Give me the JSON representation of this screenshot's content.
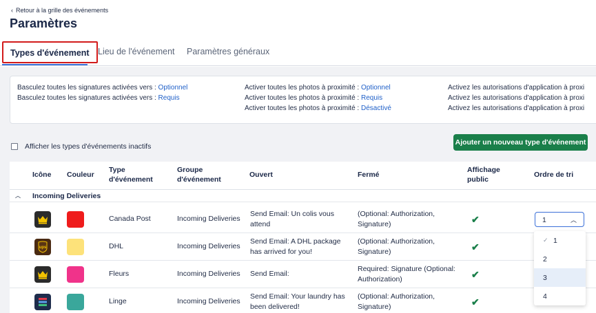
{
  "header": {
    "back_link": "Retour à la grille des événements",
    "title": "Paramètres"
  },
  "tabs": [
    {
      "label": "Types d'événement",
      "active": true
    },
    {
      "label": "Lieu de l'événement",
      "active": false
    },
    {
      "label": "Paramètres généraux",
      "active": false
    }
  ],
  "bulk_settings": {
    "col1": [
      {
        "prefix": "Basculez toutes les signatures activées vers :",
        "link": "Optionnel"
      },
      {
        "prefix": "Basculez toutes les signatures activées vers :",
        "link": "Requis"
      }
    ],
    "col2": [
      {
        "prefix": "Activer toutes les photos à proximité :",
        "link": "Optionnel"
      },
      {
        "prefix": "Activer toutes les photos à proximité :",
        "link": "Requis"
      },
      {
        "prefix": "Activer toutes les photos à proximité :",
        "link": "Désactivé"
      }
    ],
    "col3": [
      {
        "prefix": "Activez les autorisations d'application à proxi"
      },
      {
        "prefix": "Activez les autorisations d'application à proxi"
      },
      {
        "prefix": "Activez les autorisations d'application à proxi"
      }
    ]
  },
  "filters": {
    "show_inactive_label": "Afficher les types d'événements inactifs",
    "show_inactive_checked": false
  },
  "add_button": "Ajouter un nouveau type d'événement",
  "table": {
    "headers": {
      "icon": "Icône",
      "color": "Couleur",
      "type_l1": "Type",
      "type_l2": "d'événement",
      "group_l1": "Groupe",
      "group_l2": "d'événement",
      "open": "Ouvert",
      "closed": "Fermé",
      "public_l1": "Affichage",
      "public_l2": "public",
      "sort": "Ordre de tri"
    },
    "group_name": "Incoming Deliveries",
    "rows": [
      {
        "icon": "crown-icon",
        "color": "#ef1c1c",
        "type": "Canada Post",
        "group": "Incoming Deliveries",
        "open_l1": "Send Email: Un colis vous",
        "open_l2": "attend",
        "closed_l1": "(Optional: Authorization,",
        "closed_l2": "Signature)",
        "public": true,
        "sort": "1"
      },
      {
        "icon": "ups-icon",
        "color": "#fde27a",
        "type": "DHL",
        "group": "Incoming Deliveries",
        "open_l1": "Send Email: A DHL package",
        "open_l2": "has arrived for you!",
        "closed_l1": "(Optional: Authorization,",
        "closed_l2": "Signature)",
        "public": true,
        "sort": ""
      },
      {
        "icon": "crown-icon",
        "color": "#f0338a",
        "type": "Fleurs",
        "group": "Incoming Deliveries",
        "open_l1": "Send Email:",
        "open_l2": "",
        "closed_l1": "Required: Signature (Optional:",
        "closed_l2": "Authorization)",
        "public": true,
        "sort": ""
      },
      {
        "icon": "laundry-icon",
        "color": "#3aa79b",
        "type": "Linge",
        "group": "Incoming Deliveries",
        "open_l1": "Send Email: Your laundry has",
        "open_l2": "been delivered!",
        "closed_l1": "(Optional: Authorization,",
        "closed_l2": "Signature)",
        "public": true,
        "sort": ""
      }
    ]
  },
  "sort_dropdown": {
    "options": [
      "1",
      "2",
      "3",
      "4"
    ],
    "selected": "1",
    "highlighted": "3"
  }
}
